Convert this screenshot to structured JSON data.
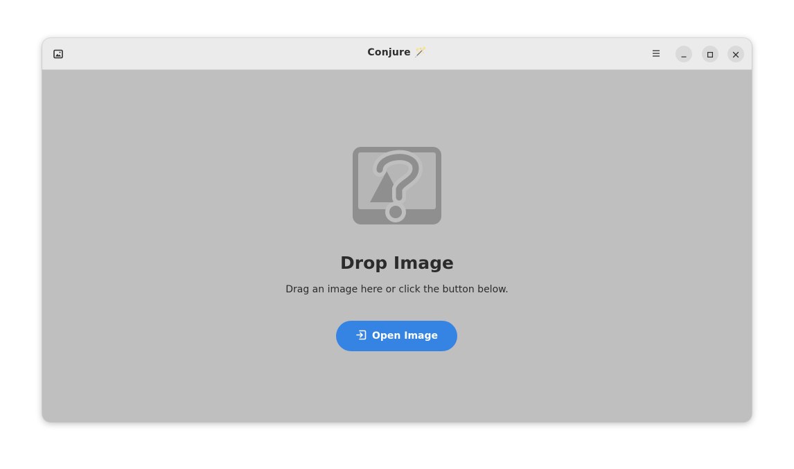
{
  "window": {
    "title": "Conjure",
    "title_emoji": "🪄",
    "app_icon": "image-icon",
    "controls": {
      "menu_icon": "hamburger-menu-icon",
      "minimize_icon": "minimize-icon",
      "maximize_icon": "maximize-icon",
      "close_icon": "close-icon"
    }
  },
  "status_page": {
    "icon": "image-missing-icon",
    "title": "Drop Image",
    "description": "Drag an image here or click the button below.",
    "button": {
      "label": "Open Image",
      "icon": "document-open-icon"
    }
  },
  "colors": {
    "accent": "#3584e4",
    "content_bg": "#bfbfbf",
    "headerbar_bg": "#ebebeb"
  }
}
